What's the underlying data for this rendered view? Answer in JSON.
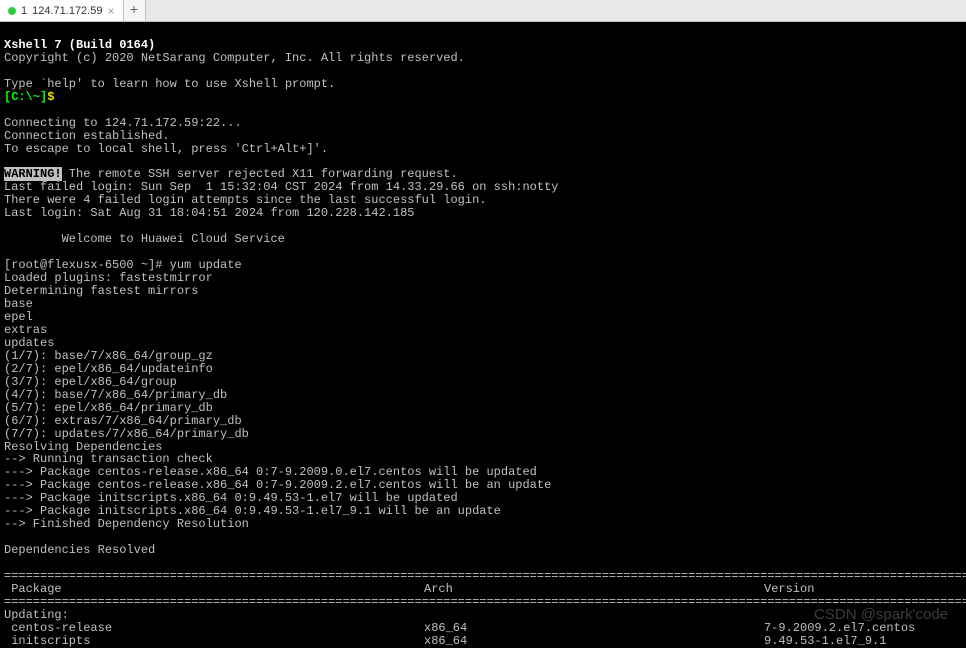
{
  "tab": {
    "index": "1",
    "title": "124.71.172.59"
  },
  "header": {
    "title": "Xshell 7 (Build 0164)",
    "copyright": "Copyright (c) 2020 NetSarang Computer, Inc. All rights reserved.",
    "help": "Type `help' to learn how to use Xshell prompt.",
    "prompt_open": "[C:\\~]",
    "prompt_dollar": "$"
  },
  "conn": {
    "connecting": "Connecting to 124.71.172.59:22...",
    "established": "Connection established.",
    "escape": "To escape to local shell, press 'Ctrl+Alt+]'."
  },
  "warn": {
    "label": "WARNING!",
    "x11": " The remote SSH server rejected X11 forwarding request.",
    "last_failed": "Last failed login: Sun Sep  1 15:32:04 CST 2024 from 14.33.29.66 on ssh:notty",
    "failed_count": "There were 4 failed login attempts since the last successful login.",
    "last_login": "Last login: Sat Aug 31 18:04:51 2024 from 120.228.142.185"
  },
  "welcome": "        Welcome to Huawei Cloud Service",
  "shell": {
    "prompt_user": "[root@flexusx-6500 ~]# ",
    "cmd": "yum update"
  },
  "yum": {
    "loaded": "Loaded plugins: fastestmirror",
    "determining": "Determining fastest mirrors",
    "repo1": "base",
    "repo2": "epel",
    "repo3": "extras",
    "repo4": "updates",
    "p1": "(1/7): base/7/x86_64/group_gz",
    "p2": "(2/7): epel/x86_64/updateinfo",
    "p3": "(3/7): epel/x86_64/group",
    "p4": "(4/7): base/7/x86_64/primary_db",
    "p5": "(5/7): epel/x86_64/primary_db",
    "p6": "(6/7): extras/7/x86_64/primary_db",
    "p7": "(7/7): updates/7/x86_64/primary_db",
    "resolving": "Resolving Dependencies",
    "d1": "--> Running transaction check",
    "d2": "---> Package centos-release.x86_64 0:7-9.2009.0.el7.centos will be updated",
    "d3": "---> Package centos-release.x86_64 0:7-9.2009.2.el7.centos will be an update",
    "d4": "---> Package initscripts.x86_64 0:9.49.53-1.el7 will be updated",
    "d5": "---> Package initscripts.x86_64 0:9.49.53-1.el7_9.1 will be an update",
    "d6": "--> Finished Dependency Resolution",
    "resolved": "Dependencies Resolved"
  },
  "table": {
    "sep": "================================================================================================================================================================",
    "h_pkg": " Package",
    "h_arch": "Arch",
    "h_ver": "Version",
    "updating": "Updating:",
    "r1_pkg": " centos-release",
    "r1_arch": "x86_64",
    "r1_ver": "7-9.2009.2.el7.centos",
    "r2_pkg": " initscripts",
    "r2_arch": "x86_64",
    "r2_ver": "9.49.53-1.el7_9.1"
  },
  "watermark": "CSDN @spark'code"
}
